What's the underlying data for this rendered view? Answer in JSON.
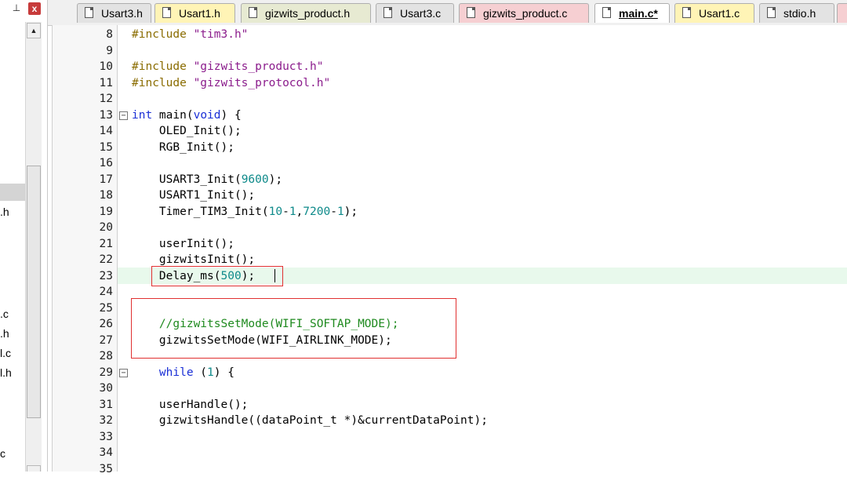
{
  "left_panel": {
    "pin_glyph": "⊥",
    "close_glyph": "x",
    "tree_fragments": [
      ".h",
      ".c",
      ".h",
      "l.c",
      "l.h",
      "c"
    ]
  },
  "tabs": [
    {
      "label": "Usart3.h",
      "active": false,
      "color": "#e3e3e3"
    },
    {
      "label": "Usart1.h",
      "active": false,
      "color": "#fff4b6"
    },
    {
      "label": "gizwits_product.h",
      "active": false,
      "color": "#e7ead2"
    },
    {
      "label": "Usart3.c",
      "active": false,
      "color": "#e3e3e3"
    },
    {
      "label": "gizwits_product.c",
      "active": false,
      "color": "#f6cfd2"
    },
    {
      "label": "main.c*",
      "active": true,
      "color": "#ffffff"
    },
    {
      "label": "Usart1.c",
      "active": false,
      "color": "#fff4b6"
    },
    {
      "label": "stdio.h",
      "active": false,
      "color": "#e3e3e3"
    }
  ],
  "code_lines": [
    {
      "n": "8",
      "text": "#include \"tim3.h\""
    },
    {
      "n": "9",
      "text": ""
    },
    {
      "n": "10",
      "text": "#include \"gizwits_product.h\""
    },
    {
      "n": "11",
      "text": "#include \"gizwits_protocol.h\""
    },
    {
      "n": "12",
      "text": ""
    },
    {
      "n": "13",
      "text": "int main(void) {"
    },
    {
      "n": "14",
      "text": "    OLED_Init();"
    },
    {
      "n": "15",
      "text": "    RGB_Init();"
    },
    {
      "n": "16",
      "text": ""
    },
    {
      "n": "17",
      "text": "    USART3_Init(9600);"
    },
    {
      "n": "18",
      "text": "    USART1_Init();"
    },
    {
      "n": "19",
      "text": "    Timer_TIM3_Init(10-1,7200-1);"
    },
    {
      "n": "20",
      "text": ""
    },
    {
      "n": "21",
      "text": "    userInit();"
    },
    {
      "n": "22",
      "text": "    gizwitsInit();"
    },
    {
      "n": "23",
      "text": "    Delay_ms(500);"
    },
    {
      "n": "24",
      "text": ""
    },
    {
      "n": "25",
      "text": ""
    },
    {
      "n": "26",
      "text": "    //gizwitsSetMode(WIFI_SOFTAP_MODE);"
    },
    {
      "n": "27",
      "text": "    gizwitsSetMode(WIFI_AIRLINK_MODE);"
    },
    {
      "n": "28",
      "text": ""
    },
    {
      "n": "29",
      "text": "    while (1) {"
    },
    {
      "n": "30",
      "text": ""
    },
    {
      "n": "31",
      "text": "    userHandle();"
    },
    {
      "n": "32",
      "text": "    gizwitsHandle((dataPoint_t *)&currentDataPoint);"
    },
    {
      "n": "33",
      "text": ""
    },
    {
      "n": "34",
      "text": ""
    },
    {
      "n": "35",
      "text": ""
    }
  ],
  "colors": {
    "current_line": "#e8f9ec",
    "keyword": "#1a2fd6",
    "number": "#0e8a8a",
    "string": "#8b1c8c",
    "preprocessor": "#8a6c00",
    "comment": "#1f8a1f",
    "annotation_box": "#e03030"
  },
  "editor": {
    "current_line_number": "23"
  }
}
